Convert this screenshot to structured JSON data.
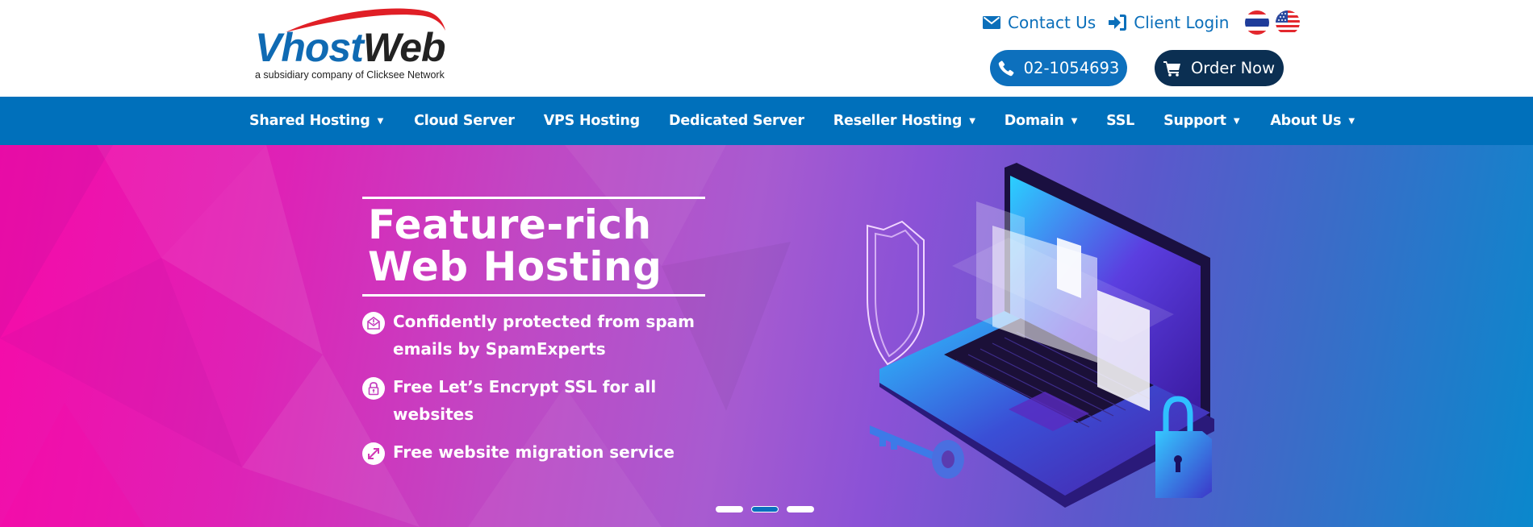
{
  "brand": {
    "name_part1": "Vhost",
    "name_part2": "Web",
    "tagline": "a subsidiary company of Clicksee Network",
    "colors": {
      "blue": "#0f6ab3",
      "dark": "#222222",
      "swoosh": "#e01f26"
    }
  },
  "header": {
    "links": [
      {
        "label": "Contact Us",
        "icon": "envelope-icon"
      },
      {
        "label": "Client Login",
        "icon": "sign-in-icon"
      }
    ],
    "languages": [
      {
        "code": "th",
        "icon": "thailand-flag-icon"
      },
      {
        "code": "en",
        "icon": "usa-flag-icon"
      }
    ],
    "phone_button": {
      "label": "02-1054693",
      "icon": "phone-icon",
      "color": "#0d70bd"
    },
    "order_button": {
      "label": "Order Now",
      "icon": "cart-icon",
      "color": "#0b2f52"
    }
  },
  "nav": {
    "color": "#0070bb",
    "items": [
      {
        "label": "Shared Hosting",
        "has_dropdown": true
      },
      {
        "label": "Cloud Server",
        "has_dropdown": false
      },
      {
        "label": "VPS Hosting",
        "has_dropdown": false
      },
      {
        "label": "Dedicated Server",
        "has_dropdown": false
      },
      {
        "label": "Reseller Hosting",
        "has_dropdown": true
      },
      {
        "label": "Domain",
        "has_dropdown": true
      },
      {
        "label": "SSL",
        "has_dropdown": false
      },
      {
        "label": "Support",
        "has_dropdown": true
      },
      {
        "label": "About Us",
        "has_dropdown": true
      }
    ],
    "caret": "▼"
  },
  "hero": {
    "title_line1": "Feature-rich",
    "title_line2": "Web Hosting",
    "features": [
      {
        "icon": "envelope-alert-icon",
        "text": "Confidently protected from spam emails by SpamExperts"
      },
      {
        "icon": "padlock-icon",
        "text": "Free Let’s Encrypt SSL for all websites"
      },
      {
        "icon": "migration-arrows-icon",
        "text": "Free website migration service"
      }
    ],
    "slider": {
      "total_slides": 3,
      "active_slide": 2
    },
    "illustration": "laptop-security-illustration"
  }
}
